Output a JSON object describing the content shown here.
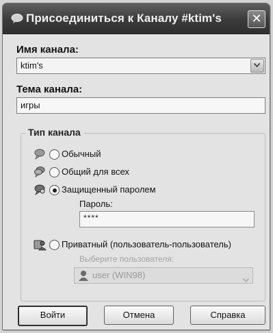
{
  "window": {
    "title": "Присоединиться к Каналу #ktim's",
    "close_glyph": "✕"
  },
  "channel_name": {
    "label": "Имя канала:",
    "value": "ktim's"
  },
  "channel_topic": {
    "label": "Тема канала:",
    "value": "игры"
  },
  "channel_type": {
    "legend": "Тип канала",
    "options": [
      {
        "label": "Обычный",
        "icon": "chat-bubble-icon",
        "checked": false
      },
      {
        "label": "Общий для всех",
        "icon": "shared-chat-icon",
        "checked": false
      },
      {
        "label": "Защищенный паролем",
        "icon": "protected-chat-icon",
        "checked": true
      },
      {
        "label": "Приватный (пользователь-пользователь)",
        "icon": "private-chat-icon",
        "checked": false
      }
    ]
  },
  "password": {
    "label": "Пароль:",
    "value": "****"
  },
  "user_select": {
    "label": "Выберите пользователя:",
    "value": "user (WIN98)",
    "icon": "user-icon"
  },
  "buttons": {
    "join": "Войти",
    "cancel": "Отмена",
    "help": "Справка"
  }
}
